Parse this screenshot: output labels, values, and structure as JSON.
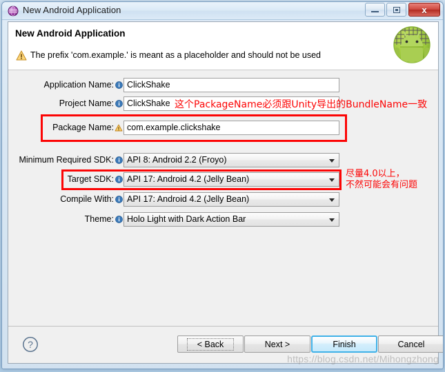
{
  "window": {
    "title": "New Android Application",
    "icon": "eclipse-sphere-icon",
    "controls": {
      "minimize": "minimize-icon",
      "maximize": "maximize-icon",
      "close_label": "x"
    }
  },
  "banner": {
    "title": "New Android Application",
    "warning_icon": "warning-triangle-icon",
    "message": "The prefix 'com.example.' is meant as a placeholder and should not be used",
    "logo": "android-robot-logo"
  },
  "form": {
    "fields": [
      {
        "label": "Application Name:",
        "hint_icon": "info-icon",
        "value": "ClickShake",
        "kind": "text"
      },
      {
        "label": "Project Name:",
        "hint_icon": "info-icon",
        "value": "ClickShake",
        "kind": "text"
      },
      {
        "label": "Package Name:",
        "hint_icon": "warning-icon",
        "value": "com.example.clickshake",
        "kind": "text"
      },
      {
        "label": "Minimum Required SDK:",
        "hint_icon": "info-icon",
        "value": "API 8: Android 2.2 (Froyo)",
        "kind": "combo"
      },
      {
        "label": "Target SDK:",
        "hint_icon": "info-icon",
        "value": "API 17: Android 4.2 (Jelly Bean)",
        "kind": "combo"
      },
      {
        "label": "Compile With:",
        "hint_icon": "info-icon",
        "value": "API 17: Android 4.2 (Jelly Bean)",
        "kind": "combo"
      },
      {
        "label": "Theme:",
        "hint_icon": "info-icon",
        "value": "Holo Light with Dark Action Bar",
        "kind": "combo"
      }
    ]
  },
  "annotations": {
    "accent_color": "#fc0505",
    "package_note": "这个PackageName必须跟Unity导出的BundleName一致",
    "target_note_line1": "尽量4.0以上，",
    "target_note_line2": "不然可能会有问题"
  },
  "footer": {
    "help_icon": "help-question-icon",
    "buttons": {
      "back": "< Back",
      "next": "Next >",
      "finish": "Finish",
      "cancel": "Cancel"
    }
  },
  "watermark": "https://blog.csdn.net/Mihongzhong"
}
